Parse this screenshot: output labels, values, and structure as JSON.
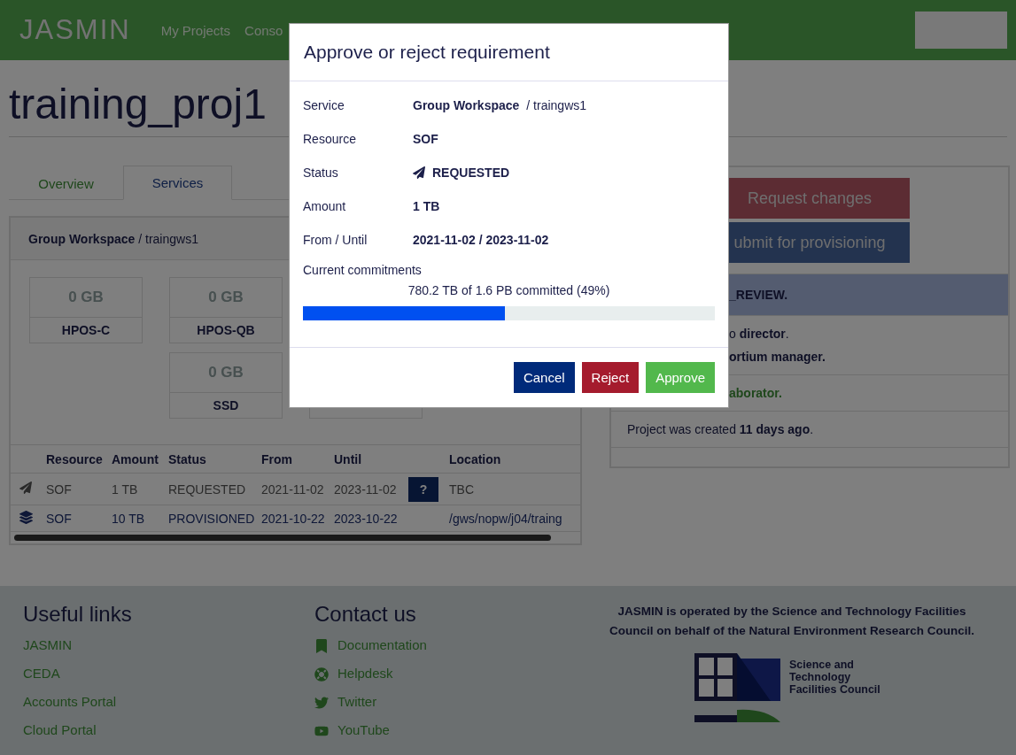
{
  "header": {
    "logo": "JASMIN",
    "nav": [
      {
        "label": "My Projects"
      },
      {
        "label": "Conso"
      }
    ]
  },
  "page": {
    "title": "training_proj1"
  },
  "tabs": [
    {
      "label": "Overview",
      "selected": false
    },
    {
      "label": "Services",
      "selected": true
    }
  ],
  "service_panel": {
    "title": "**Group Workspace** / traingws1",
    "storage_cards": [
      {
        "amount": "0 GB",
        "name": "HPOS-C"
      },
      {
        "amount": "0 GB",
        "name": "HPOS-QB"
      },
      {
        "amount": "0 GB",
        "name": "SSD"
      }
    ],
    "table": {
      "columns": [
        "Resource",
        "Amount",
        "Status",
        "From",
        "Until",
        "Location"
      ],
      "rows": [
        {
          "kind": "requested",
          "resource": "SOF",
          "amount": "1 TB",
          "status": "REQUESTED",
          "from": "2021-11-02",
          "until": "2023-11-02",
          "action": "?",
          "location": "TBC"
        },
        {
          "kind": "provisioned",
          "resource": "SOF",
          "amount": "10 TB",
          "status": "PROVISIONED",
          "from": "2021-10-22",
          "until": "2023-10-22",
          "location": "/gws/nopw/j04/traing"
        }
      ]
    }
  },
  "project_panel": {
    "buttons": [
      {
        "label": "Request changes",
        "kind": "danger"
      },
      {
        "label": "ubmit for provisioning",
        "kind": "primary"
      }
    ],
    "sections": [
      {
        "kind": "banner",
        "lines": [
          {
            "text": "_REVIEW.",
            "kind": "bold"
          }
        ]
      },
      {
        "kind": "clipped",
        "lines": [
          {
            "text": "o **director**.",
            "kind": "rich"
          },
          {
            "text": "ortium manager.",
            "kind": "bold"
          }
        ]
      },
      {
        "kind": "clipped",
        "lines": [
          {
            "text": "aborator.",
            "kind": "role"
          }
        ]
      },
      {
        "kind": "plain",
        "lines": [
          {
            "text": "Project was created **11 days ago**.",
            "kind": "rich"
          }
        ]
      }
    ]
  },
  "footer": {
    "useful_links": {
      "title": "Useful links",
      "links": [
        "JASMIN",
        "CEDA",
        "Accounts Portal",
        "Cloud Portal"
      ]
    },
    "contact": {
      "title": "Contact us",
      "links": [
        {
          "label": "Documentation",
          "kind": "bookmark"
        },
        {
          "label": "Helpdesk",
          "kind": "lifebuoy"
        },
        {
          "label": "Twitter",
          "kind": "twitter"
        },
        {
          "label": "YouTube",
          "kind": "youtube"
        }
      ]
    },
    "about": {
      "text": "JASMIN is operated by the Science and Technology Facilities Council on behalf of the Natural Environment Research Council.",
      "logo_caption": "Science and Technology Facilities Council"
    }
  },
  "modal": {
    "title": "Approve or reject requirement",
    "fields": [
      {
        "label": "Service",
        "value": "**Group Workspace** / traingws1",
        "kind": "rich"
      },
      {
        "label": "Resource",
        "value": "SOF",
        "kind": "bold"
      },
      {
        "label": "Status",
        "value": "REQUESTED",
        "kind": "status"
      },
      {
        "label": "Amount",
        "value": "1 TB",
        "kind": "bold"
      },
      {
        "label": "From / Until",
        "value": "2021-11-02 / 2023-11-02",
        "kind": "bold"
      }
    ],
    "commitments": {
      "label": "Current commitments",
      "caption": "780.2 TB of 1.6 PB committed (49%)",
      "level": 0.49
    },
    "buttons": [
      {
        "label": "Cancel",
        "kind": "cancel"
      },
      {
        "label": "Reject",
        "kind": "reject"
      },
      {
        "label": "Approve",
        "kind": "approve"
      }
    ]
  }
}
